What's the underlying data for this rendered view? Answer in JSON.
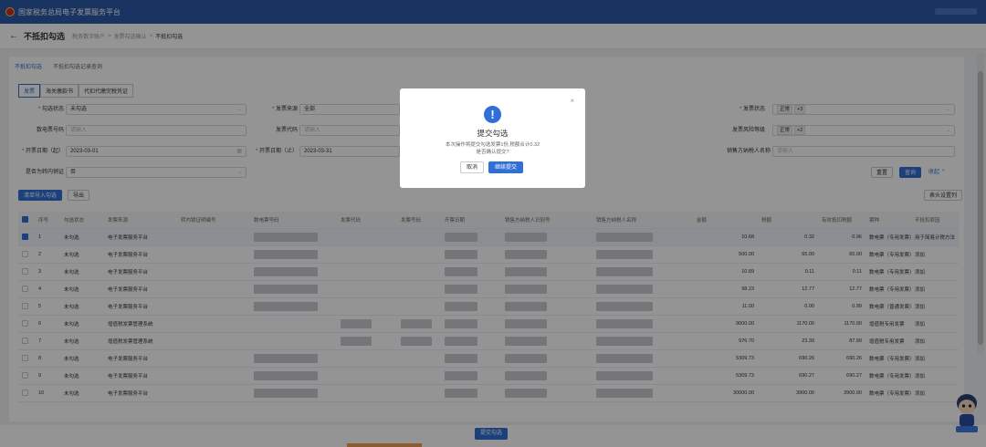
{
  "app": {
    "title": "国家税务总局电子发票服务平台"
  },
  "page": {
    "back_icon": "arrow-left-icon",
    "title": "不抵扣勾选",
    "breadcrumbs": [
      "税务数字账户",
      "发票勾选确认",
      "不抵扣勾选"
    ]
  },
  "tabs": [
    "不抵扣勾选",
    "不抵扣勾选记录查询"
  ],
  "doc_types": [
    "发票",
    "海关缴款书",
    "代扣代缴完税凭证"
  ],
  "filters": {
    "check_status": {
      "label": "勾选状态",
      "value": "未勾选"
    },
    "invoice_source": {
      "label": "发票来源",
      "value": "全部"
    },
    "invoice_status": {
      "label": "发票状态",
      "tag": "正常",
      "more": "+3"
    },
    "digital_invoice_no": {
      "label": "数电票号码",
      "placeholder": "请输入"
    },
    "invoice_code": {
      "label": "发票代码",
      "placeholder": "请输入"
    },
    "risk_level": {
      "label": "发票风险等级",
      "tag": "正常",
      "more": "+2"
    },
    "date_start": {
      "label": "开票日期（起）",
      "value": "2023-03-01"
    },
    "date_end": {
      "label": "开票日期（止）",
      "value": "2023-03-31"
    },
    "seller_tax_id": {
      "label": "销售方纳税人名称",
      "placeholder": "请输入"
    },
    "is_transferred": {
      "label": "是否为转内销证",
      "value": "否"
    }
  },
  "buttons": {
    "reset": "重置",
    "query": "查询",
    "collapse": "收起",
    "add_list": "清单导入勾选",
    "export": "导出",
    "column_set": "表头设置列"
  },
  "table": {
    "headers": [
      "序号",
      "勾选状态",
      "发票来源",
      "转内销证明编号",
      "数电票号码",
      "发票代码",
      "发票号码",
      "开票日期",
      "销售方纳税人识别号",
      "销售方纳税人名称",
      "金额",
      "税额",
      "有效抵扣税额",
      "票种",
      "不抵扣原因"
    ],
    "rows": [
      {
        "idx": "1",
        "status": "未勾选",
        "source": "电子发票服务平台",
        "amount": "10.68",
        "tax": "0.32",
        "eff": "0.96",
        "type": "数电票（专用发票）",
        "reason": "用于简易计税方法"
      },
      {
        "idx": "2",
        "status": "未勾选",
        "source": "电子发票服务平台",
        "amount": "500.00",
        "tax": "65.00",
        "eff": "65.00",
        "type": "数电票（专用发票）",
        "reason": "添加"
      },
      {
        "idx": "3",
        "status": "未勾选",
        "source": "电子发票服务平台",
        "amount": "10.89",
        "tax": "0.11",
        "eff": "0.11",
        "type": "数电票（专用发票）",
        "reason": "添加"
      },
      {
        "idx": "4",
        "status": "未勾选",
        "source": "电子发票服务平台",
        "amount": "98.23",
        "tax": "12.77",
        "eff": "12.77",
        "type": "数电票（专用发票）",
        "reason": "添加"
      },
      {
        "idx": "5",
        "status": "未勾选",
        "source": "电子发票服务平台",
        "amount": "11.00",
        "tax": "0.00",
        "eff": "0.99",
        "type": "数电票（普通发票）",
        "reason": "添加"
      },
      {
        "idx": "6",
        "status": "未勾选",
        "source": "增值税发票管理系统",
        "amount": "9000.00",
        "tax": "1170.00",
        "eff": "1170.00",
        "type": "增值税专用发票",
        "reason": "添加"
      },
      {
        "idx": "7",
        "status": "未勾选",
        "source": "增值税发票管理系统",
        "amount": "976.70",
        "tax": "23.30",
        "eff": "87.90",
        "type": "增值税专用发票",
        "reason": "添加"
      },
      {
        "idx": "8",
        "status": "未勾选",
        "source": "电子发票服务平台",
        "amount": "5309.73",
        "tax": "690.26",
        "eff": "690.26",
        "type": "数电票（专用发票）",
        "reason": "添加"
      },
      {
        "idx": "9",
        "status": "未勾选",
        "source": "电子发票服务平台",
        "amount": "5309.73",
        "tax": "690.27",
        "eff": "690.27",
        "type": "数电票（专用发票）",
        "reason": "添加"
      },
      {
        "idx": "10",
        "status": "未勾选",
        "source": "电子发票服务平台",
        "amount": "30000.00",
        "tax": "3900.00",
        "eff": "3900.00",
        "type": "数电票（专用发票）",
        "reason": "添加"
      }
    ]
  },
  "submit_button": "提交勾选",
  "dialog": {
    "title": "提交勾选",
    "message_line1": "本次操作将提交勾选发票1份,税额合计0.32",
    "message_line2": "是否确认提交?",
    "cancel": "取消",
    "confirm": "继续提交",
    "icon": "warning-icon",
    "close_icon": "close-icon"
  },
  "colors": {
    "header_blue": "#2d5ba8",
    "primary": "#2f6fd6"
  }
}
